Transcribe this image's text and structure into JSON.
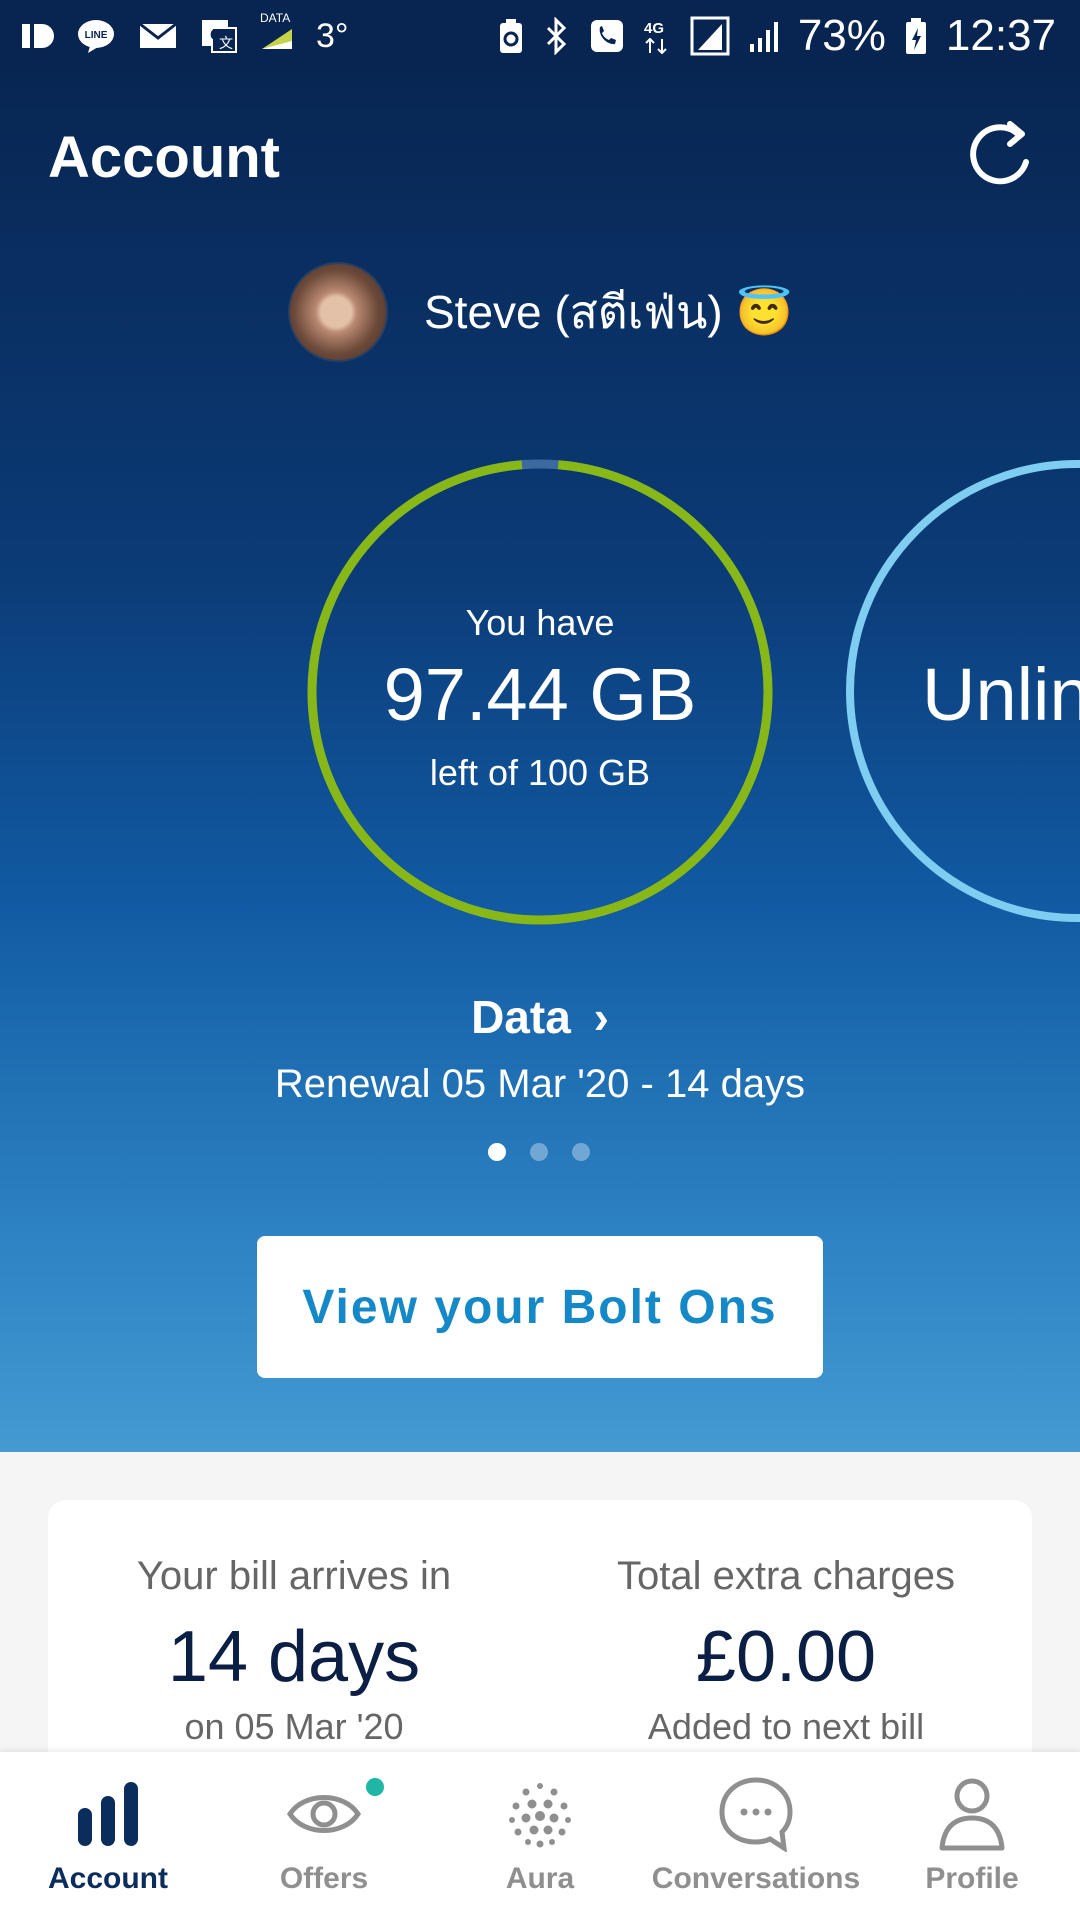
{
  "statusbar": {
    "temperature": "3°",
    "data_label": "DATA",
    "network": "4G",
    "battery": "73%",
    "time": "12:37",
    "icons": [
      "id-icon",
      "line-icon",
      "mail-icon",
      "translate-icon",
      "data-icon",
      "battery-saver-icon",
      "bluetooth-icon",
      "call-icon",
      "network-4g-icon",
      "signal-icon",
      "signal-2-icon",
      "battery-icon"
    ]
  },
  "header": {
    "title": "Account",
    "refresh_icon": "refresh-icon"
  },
  "user": {
    "name": "Steve (สตีเฟ่น) 😇"
  },
  "usage": {
    "prefix": "You have",
    "value": "97.44 GB",
    "suffix": "left of 100 GB",
    "remaining_gb": 97.44,
    "total_gb": 100,
    "ring_color": "#88b818",
    "track_color": "#3d6a9e"
  },
  "next_plan": {
    "partial_text": "Unlin",
    "ring_color": "#7fcdf0"
  },
  "plan": {
    "title": "Data",
    "chevron": "›",
    "renewal": "Renewal 05 Mar '20 - 14 days"
  },
  "carousel": {
    "count": 3,
    "active": 0
  },
  "bolt_ons_button": "View your Bolt Ons",
  "bill": {
    "arrives_label": "Your bill arrives in",
    "arrives_value": "14 days",
    "arrives_date": "on 05 Mar '20",
    "charges_label": "Total extra charges",
    "charges_value": "£0.00",
    "charges_note": "Added to next bill"
  },
  "nav": {
    "items": [
      {
        "label": "Account",
        "icon": "bar-chart-icon",
        "active": true
      },
      {
        "label": "Offers",
        "icon": "eye-icon",
        "badge": true
      },
      {
        "label": "Aura",
        "icon": "aura-dots-icon"
      },
      {
        "label": "Conversations",
        "icon": "chat-bubble-icon"
      },
      {
        "label": "Profile",
        "icon": "person-icon"
      }
    ]
  }
}
